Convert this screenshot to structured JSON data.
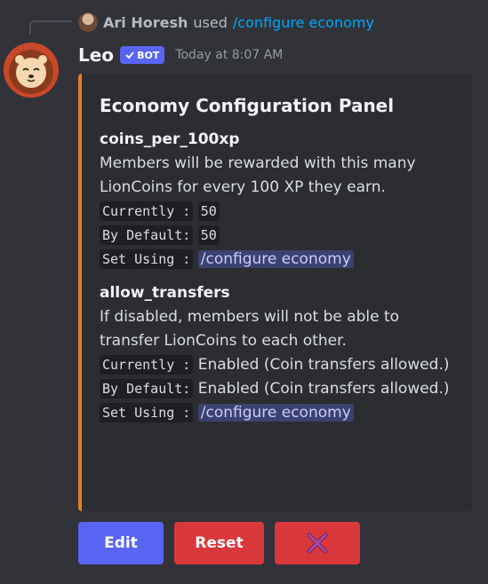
{
  "reply": {
    "user": "Ari Horesh",
    "used": "used",
    "command": "/configure economy"
  },
  "message": {
    "username": "Leo",
    "bot_badge": "BOT",
    "timestamp": "Today at 8:07 AM"
  },
  "embed": {
    "accent_color": "#e67e22",
    "title": "Economy Configuration Panel",
    "fields": [
      {
        "name": "coins_per_100xp",
        "description": "Members will be rewarded with this many LionCoins for every 100 XP they earn.",
        "currently_label": "Currently :",
        "currently_value": "50",
        "default_label": "By Default:",
        "default_value": "50",
        "set_using_label": "Set Using :",
        "set_using_value": "/configure economy"
      },
      {
        "name": "allow_transfers",
        "description": "If disabled, members will not be able to transfer LionCoins to each other.",
        "currently_label": "Currently :",
        "currently_value": "Enabled (Coin transfers allowed.)",
        "default_label": "By Default:",
        "default_value": "Enabled (Coin transfers allowed.)",
        "set_using_label": "Set Using :",
        "set_using_value": "/configure economy"
      }
    ]
  },
  "buttons": {
    "edit": "Edit",
    "reset": "Reset",
    "close_icon": "cross-swords-icon"
  },
  "colors": {
    "blurple": "#5865f2",
    "red": "#da373c",
    "link": "#00a8fc"
  }
}
